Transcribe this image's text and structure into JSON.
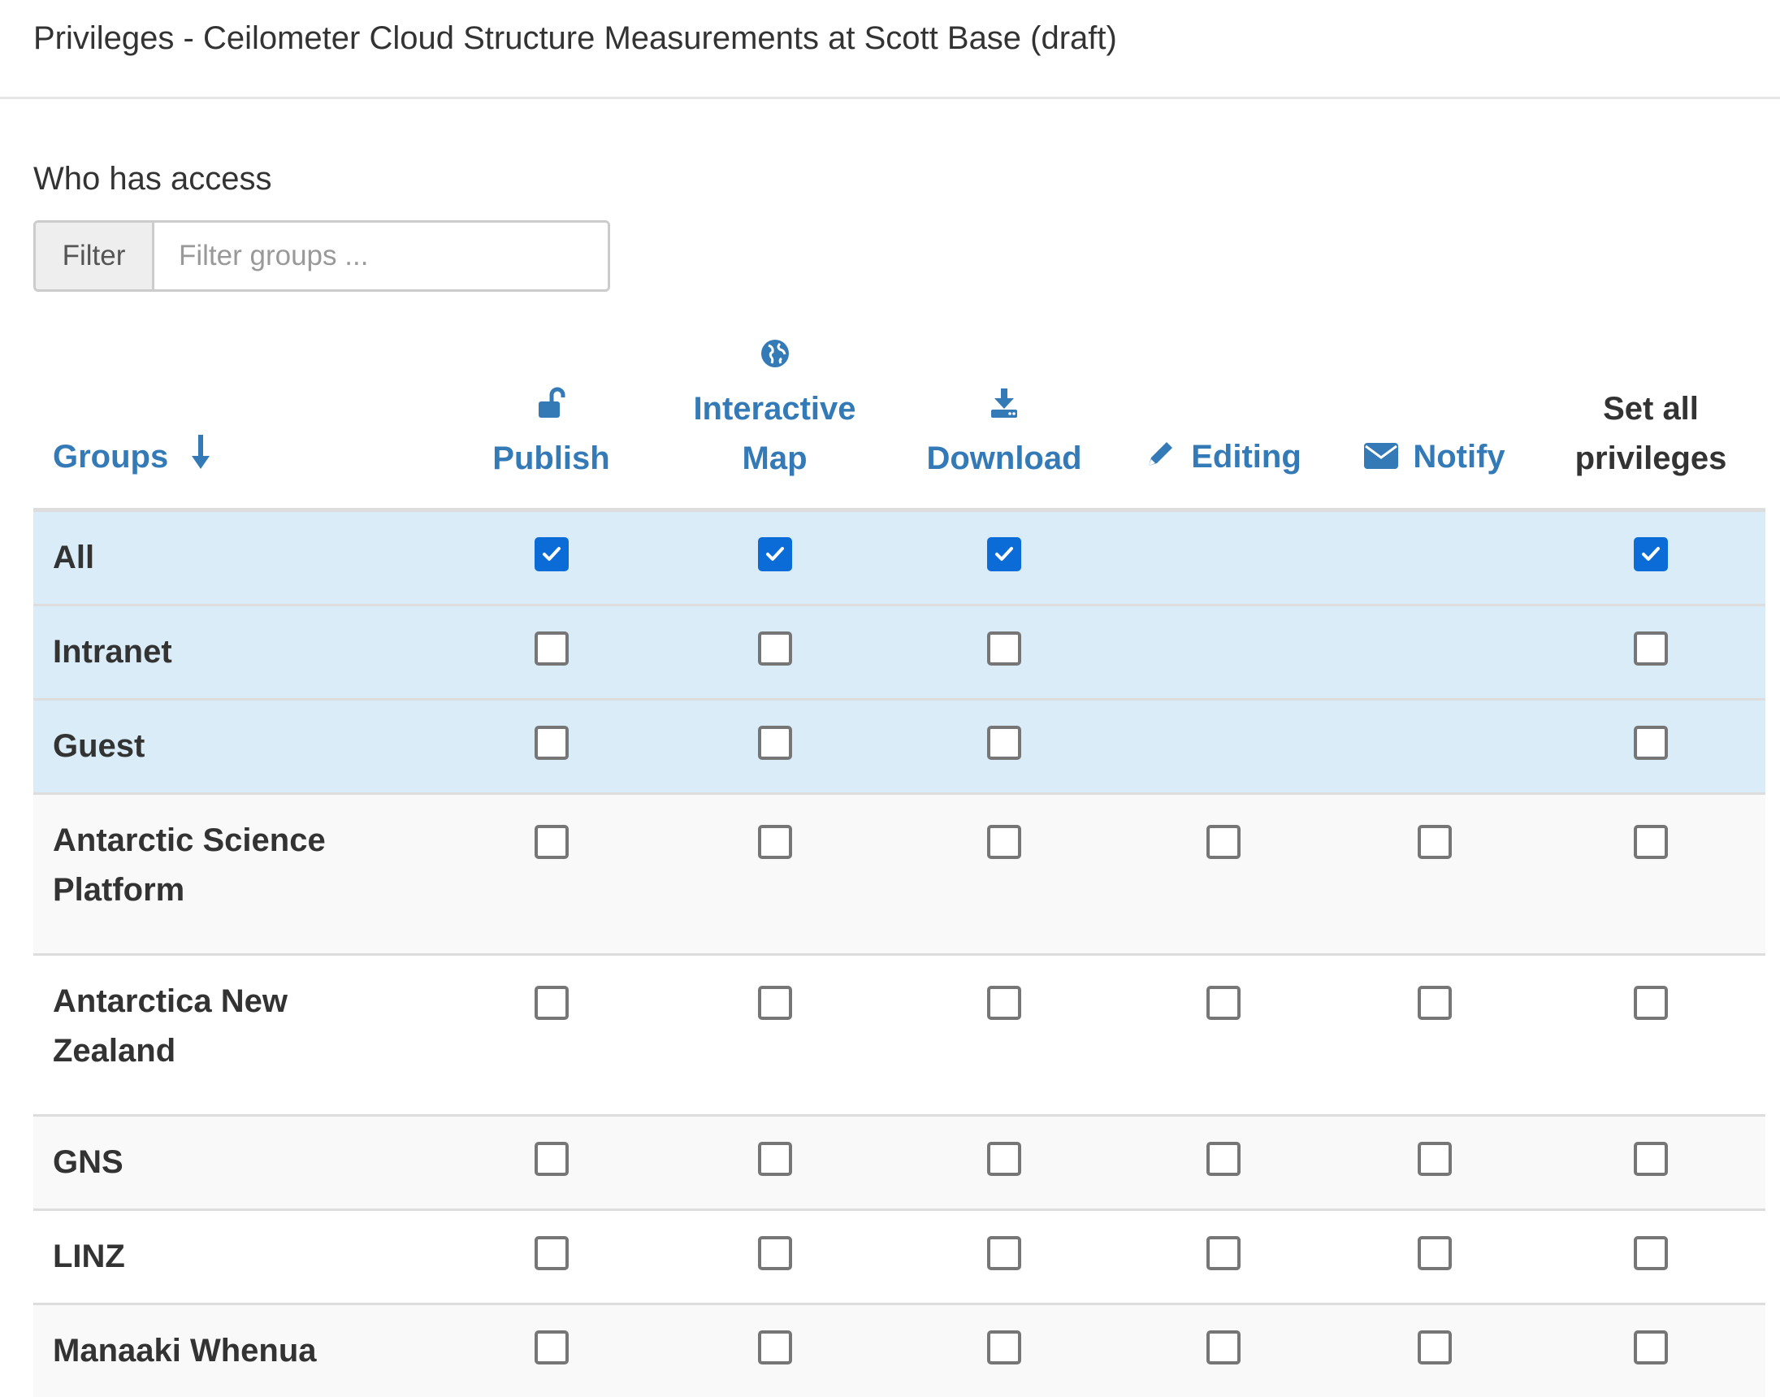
{
  "header": {
    "title": "Privileges - Ceilometer Cloud Structure Measurements at Scott Base (draft)"
  },
  "access": {
    "title": "Who has access",
    "filter_label": "Filter",
    "filter_placeholder": "Filter groups ...",
    "filter_value": ""
  },
  "columns": {
    "groups": {
      "label": "Groups",
      "icon": "sort-down-icon"
    },
    "publish": {
      "label": "Publish",
      "icon": "unlock-icon"
    },
    "interactive_map": {
      "label_line1": "Interactive",
      "label_line2": "Map",
      "icon": "globe-icon"
    },
    "download": {
      "label": "Download",
      "icon": "download-icon"
    },
    "editing": {
      "label": "Editing",
      "icon": "pencil-icon"
    },
    "notify": {
      "label": "Notify",
      "icon": "envelope-icon"
    },
    "set_all": {
      "label_line1": "Set all",
      "label_line2": "privileges"
    }
  },
  "colors": {
    "link": "#337ab7",
    "special_row_bg": "#d9ecf7",
    "checkbox_checked": "#0b6cd8"
  },
  "rows": [
    {
      "name": "All",
      "special": true,
      "publish": true,
      "map": true,
      "download": true,
      "editing": null,
      "notify": null,
      "set_all": true
    },
    {
      "name": "Intranet",
      "special": true,
      "publish": false,
      "map": false,
      "download": false,
      "editing": null,
      "notify": null,
      "set_all": false
    },
    {
      "name": "Guest",
      "special": true,
      "publish": false,
      "map": false,
      "download": false,
      "editing": null,
      "notify": null,
      "set_all": false
    },
    {
      "name_line1": "Antarctic Science",
      "name_line2": "Platform",
      "publish": false,
      "map": false,
      "download": false,
      "editing": false,
      "notify": false,
      "set_all": false
    },
    {
      "name_line1": "Antarctica New",
      "name_line2": "Zealand",
      "publish": false,
      "map": false,
      "download": false,
      "editing": false,
      "notify": false,
      "set_all": false
    },
    {
      "name": "GNS",
      "publish": false,
      "map": false,
      "download": false,
      "editing": false,
      "notify": false,
      "set_all": false
    },
    {
      "name": "LINZ",
      "publish": false,
      "map": false,
      "download": false,
      "editing": false,
      "notify": false,
      "set_all": false
    },
    {
      "name": "Manaaki Whenua",
      "publish": false,
      "map": false,
      "download": false,
      "editing": false,
      "notify": false,
      "set_all": false
    }
  ]
}
